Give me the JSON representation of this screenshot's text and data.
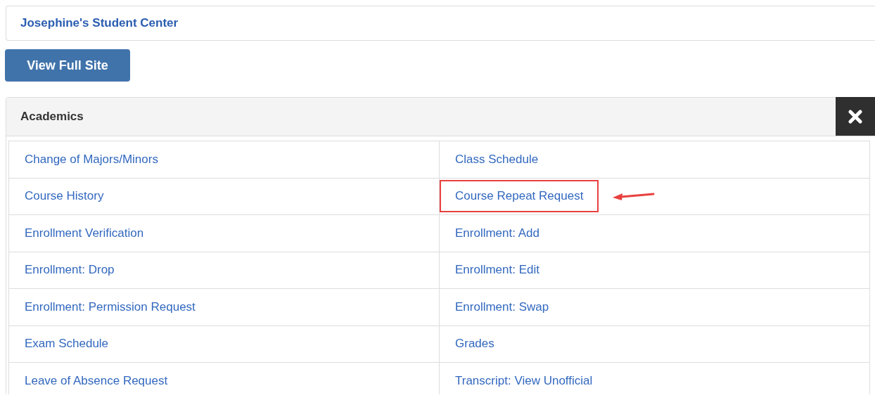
{
  "header": {
    "title": "Josephine's Student Center"
  },
  "view_full_site_button": {
    "label": "View Full Site"
  },
  "panel": {
    "title": "Academics",
    "links": [
      {
        "label": "Change of Majors/Minors",
        "highlighted": false
      },
      {
        "label": "Class Schedule",
        "highlighted": false
      },
      {
        "label": "Course History",
        "highlighted": false
      },
      {
        "label": "Course Repeat Request",
        "highlighted": true
      },
      {
        "label": "Enrollment Verification",
        "highlighted": false
      },
      {
        "label": "Enrollment: Add",
        "highlighted": false
      },
      {
        "label": "Enrollment: Drop",
        "highlighted": false
      },
      {
        "label": "Enrollment: Edit",
        "highlighted": false
      },
      {
        "label": "Enrollment: Permission Request",
        "highlighted": false
      },
      {
        "label": "Enrollment: Swap",
        "highlighted": false
      },
      {
        "label": "Exam Schedule",
        "highlighted": false
      },
      {
        "label": "Grades",
        "highlighted": false
      },
      {
        "label": "Leave of Absence Request",
        "highlighted": false
      },
      {
        "label": "Transcript: View Unofficial",
        "highlighted": false
      }
    ]
  }
}
